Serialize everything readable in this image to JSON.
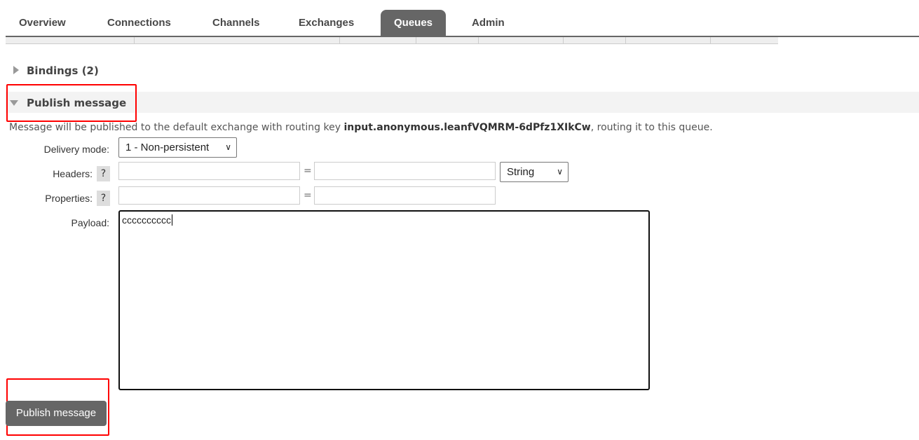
{
  "nav": {
    "tabs": [
      {
        "label": "Overview"
      },
      {
        "label": "Connections"
      },
      {
        "label": "Channels"
      },
      {
        "label": "Exchanges"
      },
      {
        "label": "Queues",
        "active": true
      },
      {
        "label": "Admin"
      }
    ]
  },
  "bindings": {
    "label": "Bindings (2)"
  },
  "publish": {
    "section_label": "Publish message",
    "info_prefix": "Message will be published to the default exchange with routing key ",
    "routing_key": "input.anonymous.leanfVQMRM-6dPfz1XIkCw",
    "info_suffix": ", routing it to this queue.",
    "delivery_mode_label": "Delivery mode:",
    "delivery_mode_value": "1 - Non-persistent",
    "headers_label": "Headers:",
    "headers_type": "String",
    "properties_label": "Properties:",
    "help": "?",
    "equals": "=",
    "payload_label": "Payload:",
    "payload_value": "cccccccccc",
    "button_label": "Publish message"
  },
  "colors": {
    "tab_active": "#666666",
    "highlight": "#ff0000",
    "button": "#666666"
  }
}
